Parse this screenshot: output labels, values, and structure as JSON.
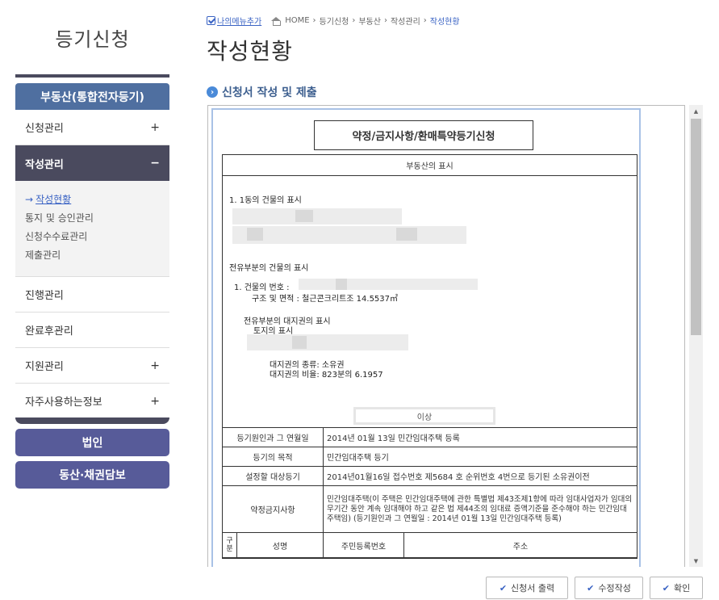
{
  "sidebar": {
    "title": "등기신청",
    "main_button": "부동산(통합전자등기)",
    "items": [
      {
        "label": "신청관리",
        "sign": "+"
      },
      {
        "label": "작성관리",
        "sign": "−"
      },
      {
        "label": "진행관리",
        "sign": ""
      },
      {
        "label": "완료후관리",
        "sign": ""
      },
      {
        "label": "지원관리",
        "sign": "+"
      },
      {
        "label": "자주사용하는정보",
        "sign": "+"
      }
    ],
    "sub_arrow": "→",
    "sub_items": [
      "작성현황",
      "통지 및 승인관리",
      "신청수수료관리",
      "제출관리"
    ],
    "pills": [
      "법인",
      "동산·채권담보"
    ]
  },
  "breadcrumb": {
    "my_menu": "나의메뉴추가",
    "items": [
      "HOME",
      "등기신청",
      "부동산",
      "작성관리",
      "작성현황"
    ],
    "sep": "›"
  },
  "page_title": "작성현황",
  "section_title": "신청서 작성 및 제출",
  "document": {
    "title": "약정/금지사항/환매특약등기신청",
    "re_header": "부동산의 표시",
    "line1": "1. 1동의 건물의 표시",
    "line2": "전유부분의 건물의 표시",
    "line3": "1. 건물의 번호 :",
    "line4": "구조 및 면적 : 철근콘크리트조 14.5537㎡",
    "line5": "전유부분의 대지권의 표시",
    "line6": "토지의 표시",
    "line7": "대지권의 종류: 소유권",
    "line8": "대지권의 비율: 823분의 6.1957",
    "ileop": "이상",
    "rows": [
      {
        "key": "등기원인과 그 연월일",
        "value": "2014년 01월 13일   민간임대주택 등록"
      },
      {
        "key": "등기의 목적",
        "value": "민간임대주택 등기"
      },
      {
        "key": "설정할 대상등기",
        "value": "2014년01월16일 접수번호 제5684 호 순위번호 4번으로 등기된 소유권이전"
      },
      {
        "key": "약정금지사항",
        "value": "민간임대주택(이 주택은 민간임대주택에 관한 특별법 제43조제1항에 따라 임대사업자가 임대의무기간 동안 계속 임대해야 하고 같은 법 제44조의 임대료 증액기준을 준수해야 하는 민간임대주택임) (등기원인과 그 연월일 : 2014년 01월 13일 민간임대주택 등록)"
      }
    ],
    "col_gubun": "구분",
    "col_name": "성명",
    "col_rrn": "주민등록번호",
    "col_addr": "주소"
  },
  "buttons": {
    "print": "신청서 출력",
    "edit": "수정작성",
    "confirm": "확인"
  }
}
